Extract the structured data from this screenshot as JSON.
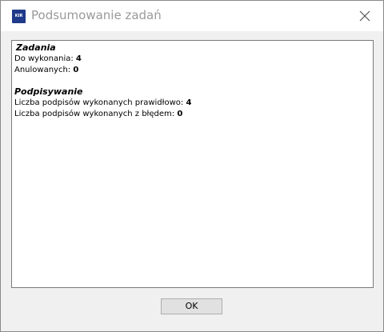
{
  "window": {
    "title": "Podsumowanie zadań",
    "icon_text": "KIR"
  },
  "summary": {
    "tasks_heading": "Zadania",
    "to_do_label": "Do wykonania:",
    "to_do_value": "4",
    "cancelled_label": "Anulowanych:",
    "cancelled_value": "0",
    "signing_heading": "Podpisywanie",
    "signed_ok_label": "Liczba podpisów wykonanych prawidłowo:",
    "signed_ok_value": "4",
    "signed_error_label": "Liczba podpisów wykonanych z błędem:",
    "signed_error_value": "0"
  },
  "buttons": {
    "ok_label": "OK"
  },
  "icons": {
    "app": "app-logo-icon",
    "close": "close-icon"
  }
}
